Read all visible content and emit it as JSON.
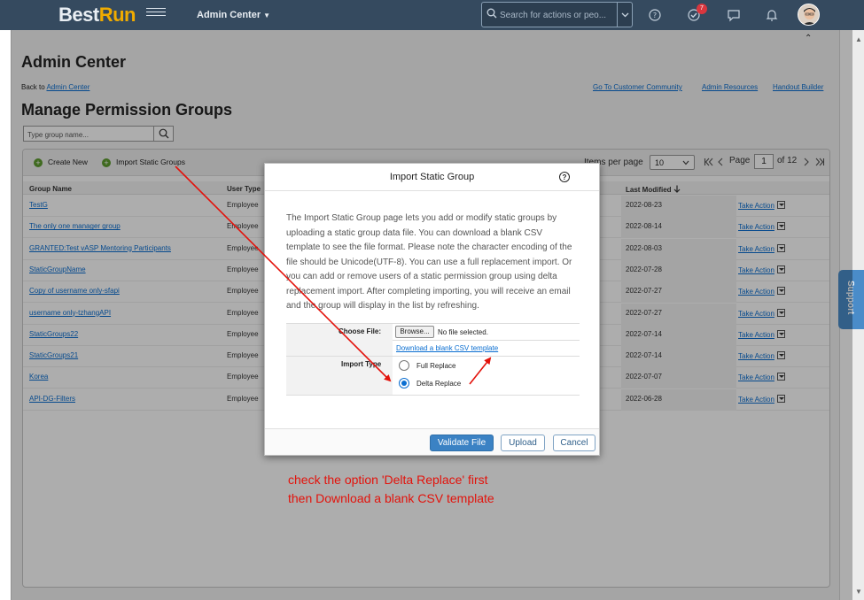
{
  "shell": {
    "logo_part1": "Best",
    "logo_part2": "Run",
    "app_menu": "Admin Center",
    "search_placeholder": "Search for actions or peo...",
    "notification_count": "7"
  },
  "page": {
    "title": "Admin Center",
    "back_prefix": "Back to",
    "back_link": "Admin Center",
    "top_links": [
      "Go To Customer Community",
      "Admin Resources",
      "Handout Builder"
    ],
    "heading": "Manage Permission Groups",
    "group_search_placeholder": "Type group name..."
  },
  "toolbar": {
    "create_new": "Create New",
    "import_static": "Import Static Groups",
    "items_per_page_label": "Items per page",
    "items_per_page_value": "10",
    "page_label": "Page",
    "page_value": "1",
    "page_total": "of 12"
  },
  "table": {
    "columns": [
      "Group Name",
      "User Type",
      "Last Modified"
    ],
    "action_label": "Take Action",
    "rows": [
      {
        "name": "TestG",
        "type": "Employee",
        "date": "2022-08-23"
      },
      {
        "name": "The only one manager group",
        "type": "Employee",
        "date": "2022-08-14"
      },
      {
        "name": "GRANTED:Test vASP Mentoring Participants",
        "type": "Employee",
        "date": "2022-08-03"
      },
      {
        "name": "StaticGroupName",
        "type": "Employee",
        "date": "2022-07-28"
      },
      {
        "name": "Copy of username only-sfapi",
        "type": "Employee",
        "date": "2022-07-27"
      },
      {
        "name": "username only-tzhangAPI",
        "type": "Employee",
        "date": "2022-07-27"
      },
      {
        "name": "StaticGroups22",
        "type": "Employee",
        "date": "2022-07-14"
      },
      {
        "name": "StaticGroups21",
        "type": "Employee",
        "date": "2022-07-14"
      },
      {
        "name": "Korea",
        "type": "Employee",
        "date": "2022-07-07"
      },
      {
        "name": "API-DG-Filters",
        "type": "Employee",
        "date": "2022-06-28"
      }
    ]
  },
  "support_tab": "Support",
  "dialog": {
    "title": "Import Static Group",
    "description": "The Import Static Group page lets you add or modify static groups by uploading a static group data file. You can download a blank CSV template to see the file format. Please note the character encoding of the file should be Unicode(UTF-8). You can use a full replacement import. Or you can add or remove users of a static permission group using delta replacement import. After completing importing, you will receive an email and the group will display in the list by refreshing.",
    "choose_file_label": "Choose File:",
    "browse_button": "Browse...",
    "no_file": "No file selected.",
    "download_link": "Download a blank CSV template",
    "import_type_label": "Import Type",
    "options": [
      "Full Replace",
      "Delta Replace"
    ],
    "selected_option": "Delta Replace",
    "validate_button": "Validate File",
    "upload_button": "Upload",
    "cancel_button": "Cancel"
  },
  "annotation": {
    "line1": "check the option 'Delta Replace' first",
    "line2": "then Download a blank CSV template",
    "color": "#e3120b"
  },
  "colors": {
    "shell": "#354a5f",
    "brand_accent": "#f0ab00",
    "link": "#0a6ed1",
    "primary_button": "#3b82c4",
    "support_tab": "#4a8cc9"
  }
}
